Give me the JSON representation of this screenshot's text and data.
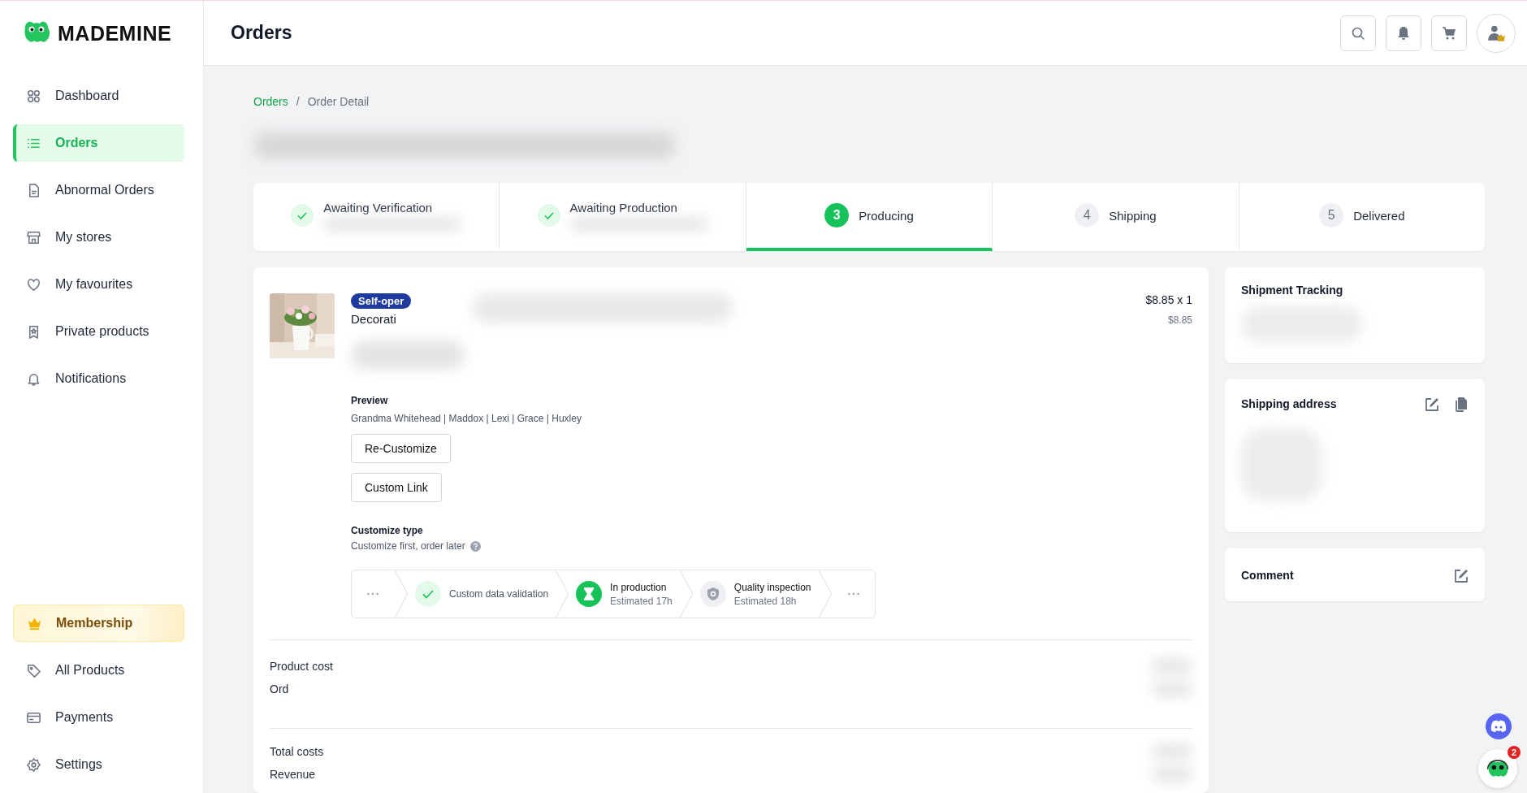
{
  "brand": {
    "name": "MADEMINE"
  },
  "sidebar": {
    "items": [
      {
        "label": "Dashboard",
        "selected": false
      },
      {
        "label": "Orders",
        "selected": true
      },
      {
        "label": "Abnormal Orders",
        "selected": false
      },
      {
        "label": "My stores",
        "selected": false
      },
      {
        "label": "My favourites",
        "selected": false
      },
      {
        "label": "Private products",
        "selected": false
      },
      {
        "label": "Notifications",
        "selected": false
      }
    ],
    "bottom_items": [
      {
        "label": "Membership",
        "kind": "premium",
        "selected": false
      },
      {
        "label": "All Products",
        "kind": "plain",
        "selected": false
      },
      {
        "label": "Payments",
        "kind": "plain",
        "selected": false
      },
      {
        "label": "Settings",
        "kind": "plain",
        "selected": false
      }
    ]
  },
  "header": {
    "title": "Orders"
  },
  "breadcrumb": [
    {
      "label": "Orders",
      "kind": "link"
    },
    {
      "separator": "/",
      "label": "Order Detail",
      "kind": "current"
    }
  ],
  "steps": [
    {
      "label": "Awaiting Verification",
      "kind": "done",
      "selected": false
    },
    {
      "label": "Awaiting Production",
      "kind": "done",
      "selected": false
    },
    {
      "number": "3",
      "label": "Producing",
      "kind": "active",
      "selected": true
    },
    {
      "number": "4",
      "label": "Shipping",
      "kind": "pending",
      "selected": false
    },
    {
      "number": "5",
      "label": "Delivered",
      "kind": "pending",
      "selected": false
    }
  ],
  "product": {
    "badge": "Self-oper",
    "title": "Decorati",
    "price": "$8.85 x 1",
    "subtotal": "$8.85",
    "preview_label": "Preview",
    "preview_text": "Grandma Whitehead | Maddox | Lexi | Grace | Huxley",
    "buttons": [
      "Re-Customize",
      "Custom Link"
    ],
    "customize_type_label": "Customize type",
    "customize_type": "Customize first, order later"
  },
  "pipeline": [
    {
      "kind": "more"
    },
    {
      "kind": "done",
      "label": "Custom data validation"
    },
    {
      "kind": "active",
      "label": "In production",
      "sub": "Estimated 17h"
    },
    {
      "kind": "pending",
      "label": "Quality inspection",
      "sub": "Estimated 18h"
    },
    {
      "kind": "more"
    }
  ],
  "costs": [
    {
      "label": "Product cost",
      "kind": "row"
    },
    {
      "label": "Ord",
      "kind": "row"
    },
    {
      "kind": "divider"
    },
    {
      "label": "Total costs",
      "kind": "row"
    },
    {
      "label": "Revenue",
      "kind": "row"
    }
  ],
  "side_cards": [
    {
      "title": "Shipment Tracking"
    },
    {
      "title": "Shipping address",
      "actions": [
        {
          "kind": "edit"
        },
        {
          "kind": "copy"
        }
      ]
    },
    {
      "title": "Comment",
      "actions": [
        {
          "kind": "edit"
        }
      ]
    }
  ],
  "chat": {
    "badge": "2"
  }
}
